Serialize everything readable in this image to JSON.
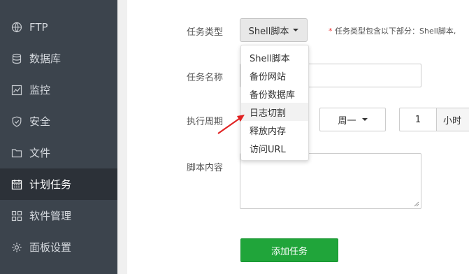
{
  "sidebar": {
    "items": [
      {
        "label": "FTP",
        "icon": "globe-icon"
      },
      {
        "label": "数据库",
        "icon": "database-icon"
      },
      {
        "label": "监控",
        "icon": "monitor-icon"
      },
      {
        "label": "安全",
        "icon": "shield-icon"
      },
      {
        "label": "文件",
        "icon": "folder-icon"
      },
      {
        "label": "计划任务",
        "icon": "calendar-icon",
        "active": true
      },
      {
        "label": "软件管理",
        "icon": "apps-icon"
      },
      {
        "label": "面板设置",
        "icon": "gear-icon"
      }
    ]
  },
  "form": {
    "task_type_label": "任务类型",
    "task_type_value": "Shell脚本",
    "task_type_note_star": "*",
    "task_type_note": "任务类型包含以下部分：Shell脚本,",
    "task_name_label": "任务名称",
    "period_label": "执行周期",
    "week_value": "周一",
    "hour_value": "1",
    "hour_unit": "小时",
    "script_label": "脚本内容",
    "submit_label": "添加任务"
  },
  "dropdown": {
    "options": [
      "Shell脚本",
      "备份网站",
      "备份数据库",
      "日志切割",
      "释放内存",
      "访问URL"
    ],
    "hovered": "日志切割"
  },
  "colors": {
    "sidebar_bg": "#3c444d",
    "sidebar_active": "#2c3138",
    "primary_green": "#20a53a",
    "annotation_red": "#e02020"
  }
}
